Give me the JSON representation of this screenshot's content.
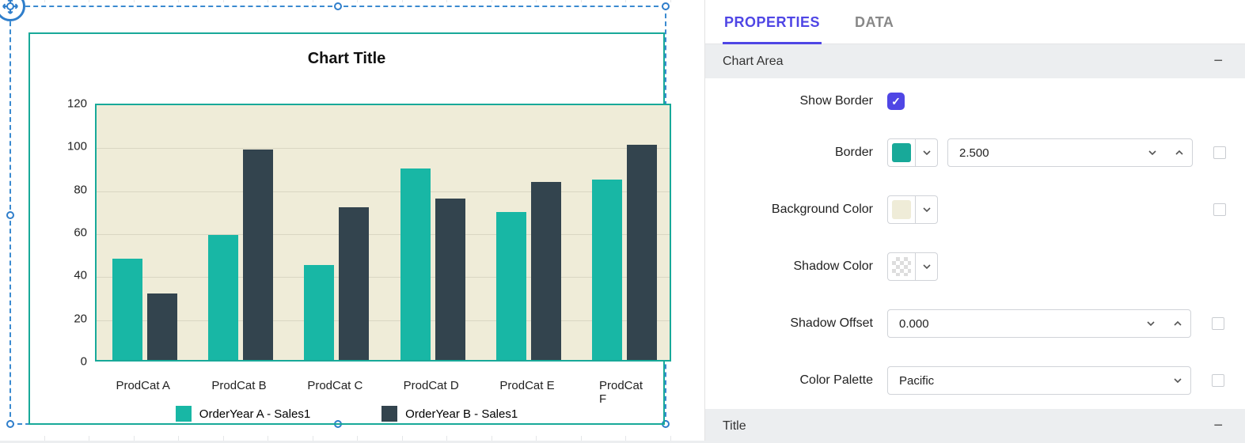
{
  "chart_data": {
    "type": "bar",
    "title": "Chart Title",
    "categories": [
      "ProdCat A",
      "ProdCat B",
      "ProdCat C",
      "ProdCat D",
      "ProdCat E",
      "ProdCat F"
    ],
    "series": [
      {
        "name": "OrderYear A - Sales1",
        "color": "#18b7a5",
        "values": [
          47,
          58,
          44,
          89,
          69,
          84
        ]
      },
      {
        "name": "OrderYear B - Sales1",
        "color": "#33444e",
        "values": [
          31,
          98,
          71,
          75,
          83,
          100
        ]
      }
    ],
    "ylabel": "",
    "xlabel": "",
    "ylim": [
      0,
      120
    ],
    "yticks": [
      0,
      20,
      40,
      60,
      80,
      100,
      120
    ]
  },
  "panel": {
    "tabs": {
      "properties": "PROPERTIES",
      "data": "DATA",
      "active": "properties"
    },
    "sections": {
      "chart_area": {
        "header": "Chart Area",
        "show_border_label": "Show Border",
        "show_border_value": true,
        "border_label": "Border",
        "border_color": "#18a999",
        "border_width": "2.500",
        "background_label": "Background Color",
        "background_color": "#efecd8",
        "shadow_color_label": "Shadow Color",
        "shadow_color": "transparent",
        "shadow_offset_label": "Shadow Offset",
        "shadow_offset": "0.000",
        "color_palette_label": "Color Palette",
        "color_palette_value": "Pacific"
      },
      "title": {
        "header": "Title"
      }
    }
  }
}
